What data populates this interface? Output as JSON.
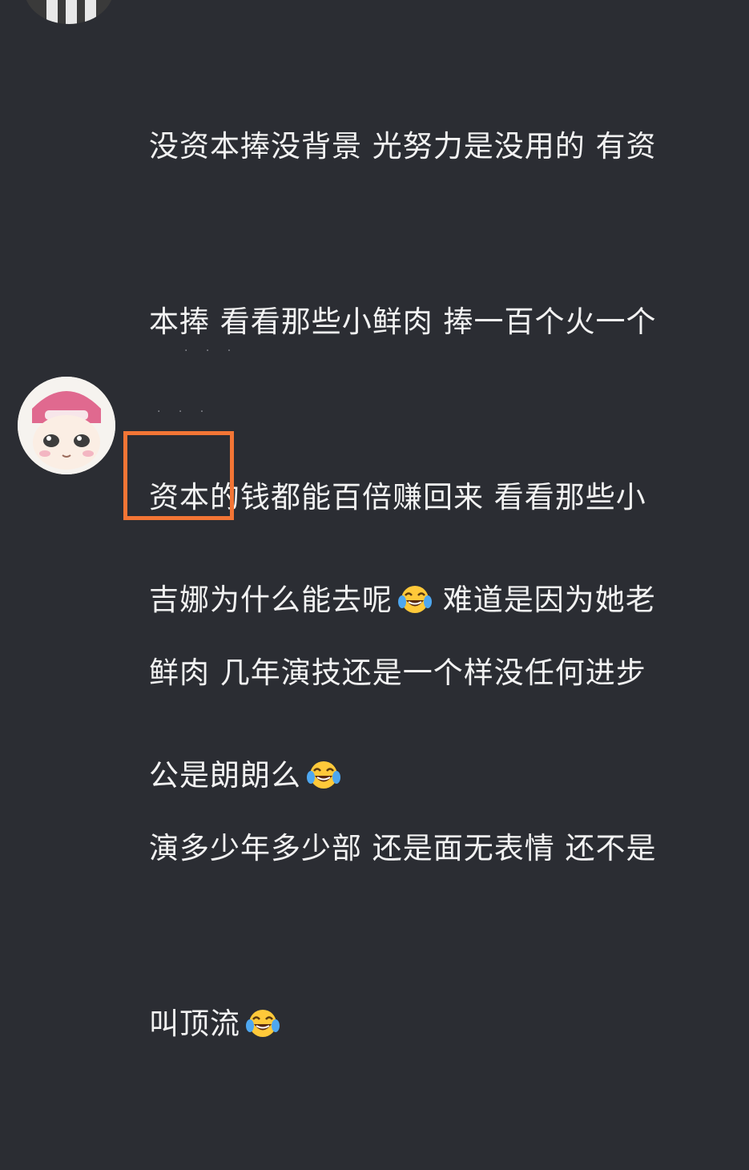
{
  "comments": [
    {
      "lines": [
        "没资本捧没背景 光努力是没用的 有资",
        "本捧 看看那些小鲜肉 捧一百个火一个",
        "资本的钱都能百倍赚回来 看看那些小",
        "鲜肉 几年演技还是一个样没任何进步",
        "演多少年多少部 还是面无表情 还不是",
        "叫顶流"
      ],
      "emoji": "laugh-cry-emoji"
    },
    {
      "line1_part1": "吉娜为什么能去呢",
      "line1_part2": "难道是因为她老",
      "line2": "公是朗朗么",
      "emoji": "laugh-cry-emoji"
    }
  ],
  "highlight_color": "#f37535",
  "background_color": "#2b2d33"
}
